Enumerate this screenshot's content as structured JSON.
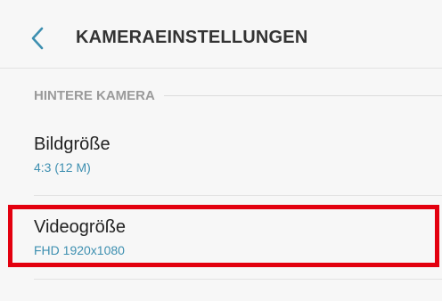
{
  "header": {
    "title": "KAMERAEINSTELLUNGEN",
    "back_icon": "chevron-left-icon"
  },
  "section": {
    "label": "HINTERE KAMERA"
  },
  "items": [
    {
      "title": "Bildgröße",
      "value": "4:3 (12 M)"
    },
    {
      "title": "Videogröße",
      "value": "FHD 1920x1080"
    }
  ],
  "colors": {
    "accent": "#3d8fb0",
    "highlight": "#e3000f",
    "background": "#f7f7f7"
  }
}
